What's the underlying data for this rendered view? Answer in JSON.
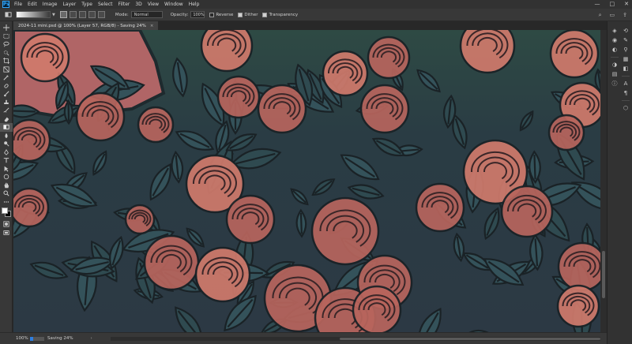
{
  "menubar": {
    "logo": "Ps",
    "items": [
      "File",
      "Edit",
      "Image",
      "Layer",
      "Type",
      "Select",
      "Filter",
      "3D",
      "View",
      "Window",
      "Help"
    ],
    "window_controls": [
      "—",
      "□",
      "✕"
    ]
  },
  "options": {
    "mode_label": "Mode:",
    "mode_value": "Normal",
    "opacity_label": "Opacity:",
    "opacity_value": "100%",
    "reverse_label": "Reverse",
    "reverse_checked": false,
    "dither_label": "Dither",
    "dither_checked": true,
    "transparency_label": "Transparency",
    "transparency_checked": true,
    "right_icons": [
      "search-icon",
      "workspace-icon",
      "share-icon"
    ]
  },
  "document": {
    "tab_title": "2024-11 mini.psd @ 100% (Layer 57, RGB/8) - Saving 24%",
    "close_glyph": "×"
  },
  "status": {
    "zoom": "100%",
    "progress": 0.24,
    "text": "Saving 24%",
    "arrow": "›"
  },
  "colors": {
    "accent": "#2f7fe0",
    "rose": "#b8655d",
    "rose_light": "#d07a6c",
    "leaf": "#2f4a50",
    "background_dark": "#23303a"
  },
  "toolbar": {
    "tools": [
      "move-icon",
      "marquee-icon",
      "lasso-icon",
      "quick-select-icon",
      "crop-icon",
      "frame-icon",
      "eyedropper-icon",
      "healing-brush-icon",
      "brush-icon",
      "clone-stamp-icon",
      "history-brush-icon",
      "eraser-icon",
      "gradient-icon",
      "blur-icon",
      "dodge-icon",
      "pen-icon",
      "type-icon",
      "path-select-icon",
      "rectangle-icon",
      "hand-icon",
      "zoom-icon",
      "more-tools-icon"
    ]
  },
  "right_panel": {
    "column_a": [
      "layers-icon",
      "channels-icon",
      "paths-icon",
      "adjustments-icon",
      "properties-icon",
      "info-icon"
    ],
    "column_b": [
      "history-icon",
      "brushes-icon",
      "clone-source-icon",
      "swatches-icon",
      "color-icon",
      "character-icon",
      "paragraph-icon",
      "3d-icon"
    ]
  }
}
